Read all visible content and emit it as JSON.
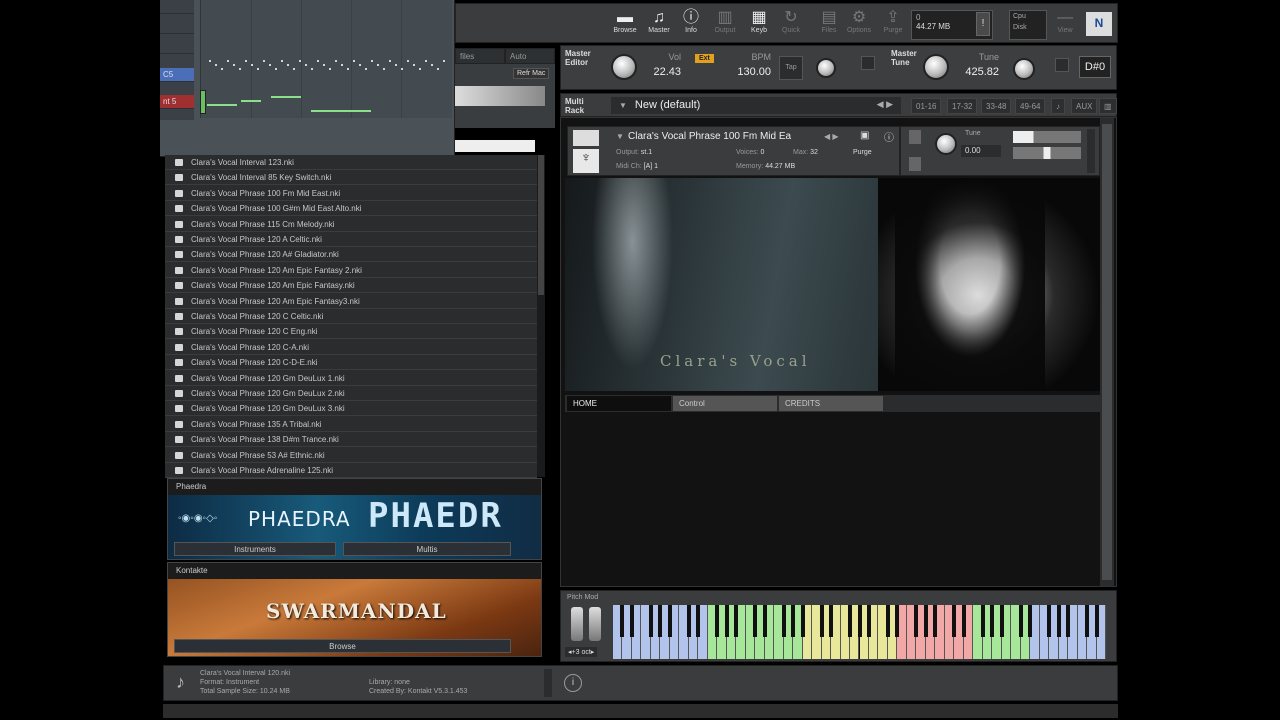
{
  "piano_roll": {
    "key_labels": [
      "",
      "",
      "",
      "",
      "C5",
      "",
      "nt 5"
    ]
  },
  "browser": {
    "tabs": [
      "files",
      "Auto"
    ],
    "buttons": [
      "Refr Mac"
    ],
    "files": [
      "Clara's Vocal Interval 123.nki",
      "Clara's Vocal Interval 85 Key Switch.nki",
      "Clara's Vocal Phrase 100 Fm Mid East.nki",
      "Clara's Vocal Phrase 100 G#m Mid East Alto.nki",
      "Clara's Vocal Phrase 115 Cm Melody.nki",
      "Clara's Vocal Phrase 120 A Celtic.nki",
      "Clara's Vocal Phrase 120 A# Gladiator.nki",
      "Clara's Vocal Phrase 120 Am Epic Fantasy 2.nki",
      "Clara's Vocal Phrase 120 Am Epic Fantasy.nki",
      "Clara's Vocal Phrase 120 Am Epic Fantasy3.nki",
      "Clara's Vocal Phrase 120 C Celtic.nki",
      "Clara's Vocal Phrase 120 C Eng.nki",
      "Clara's Vocal Phrase 120 C-A.nki",
      "Clara's Vocal Phrase 120 C-D-E.nki",
      "Clara's Vocal Phrase 120 Gm DeuLux 1.nki",
      "Clara's Vocal Phrase 120 Gm DeuLux 2.nki",
      "Clara's Vocal Phrase 120 Gm DeuLux 3.nki",
      "Clara's Vocal Phrase 135 A Tribal.nki",
      "Clara's Vocal Phrase 138 D#m Trance.nki",
      "Clara's Vocal Phrase 53 A# Ethnic.nki",
      "Clara's Vocal Phrase Adrenaline 125.nki"
    ]
  },
  "libraries": [
    {
      "name": "Phaedra",
      "logo": "PHAEDRA",
      "logo_large": "PHAEDR",
      "buttons": [
        "Instruments",
        "Multis"
      ]
    },
    {
      "name": "Kontakte",
      "logo": "SWARMANDAL",
      "buttons": [
        "Browse"
      ]
    }
  ],
  "topbar": {
    "icons": [
      {
        "label": "Browse",
        "icon": "folder-icon",
        "glyph": "▬"
      },
      {
        "label": "Master",
        "icon": "mixer-icon",
        "glyph": "♫"
      },
      {
        "label": "Info",
        "icon": "info-icon",
        "glyph": "ⓘ"
      },
      {
        "label": "Output",
        "icon": "output-icon",
        "glyph": "▥"
      },
      {
        "label": "Keyb",
        "icon": "keyboard-icon",
        "glyph": "▦"
      },
      {
        "label": "Quick",
        "icon": "quick-icon",
        "glyph": "↻"
      },
      {
        "label": "Files",
        "icon": "files-icon",
        "glyph": "▤"
      },
      {
        "label": "Options",
        "icon": "gear-icon",
        "glyph": "⚙"
      },
      {
        "label": "Purge",
        "icon": "purge-icon",
        "glyph": "⇪"
      },
      {
        "label": "View",
        "icon": "view-icon",
        "glyph": "—"
      }
    ],
    "memory_top": "0",
    "memory": "44.27 MB",
    "cpu_label": "Cpu",
    "disk_label": "Disk"
  },
  "master": {
    "editor_label": "Master Editor",
    "vol_label": "Vol",
    "vol_value": "22.43",
    "ext_label": "Ext",
    "bpm_label": "BPM",
    "bpm_value": "130.00",
    "tap_label": "Tap",
    "tune_section_label": "Master Tune",
    "tune_label": "Tune",
    "tune_value": "425.82",
    "note_value": "D#0"
  },
  "rack": {
    "label": "Multi Rack",
    "multi_name": "New (default)",
    "pages": [
      "01-16",
      "17-32",
      "33-48",
      "49-64"
    ],
    "aux_label": "AUX"
  },
  "instrument": {
    "name": "Clara's Vocal Phrase 100 Fm Mid Ea",
    "output_label": "Output:",
    "output_value": "st.1",
    "voices_label": "Voices:",
    "voices_value": "0",
    "max_label": "Max:",
    "max_value": "32",
    "purge_label": "Purge",
    "midi_label": "Midi Ch:",
    "midi_value": "[A] 1",
    "memory_label": "Memory:",
    "memory_value": "44.27 MB",
    "tune_label": "Tune",
    "tune_value": "0.00",
    "panel_title": "Clara's Vocal",
    "tabs": [
      "HOME",
      "Control",
      "CREDITS"
    ]
  },
  "keyboard": {
    "label": "Pitch Mod",
    "octave": "+3 oct"
  },
  "info": {
    "name": "Clara's Vocal Interval 120.nki",
    "format": "Format: Instrument",
    "size": "Total Sample Size: 10.24 MB",
    "library": "Library: none",
    "created": "Created By: Kontakt V5.3.1.453"
  },
  "colors": {
    "zone_green": "#a6e79a",
    "zone_yellow": "#e8e79a",
    "zone_red": "#f3a8a8",
    "zone_blue": "#b3c4ec"
  }
}
